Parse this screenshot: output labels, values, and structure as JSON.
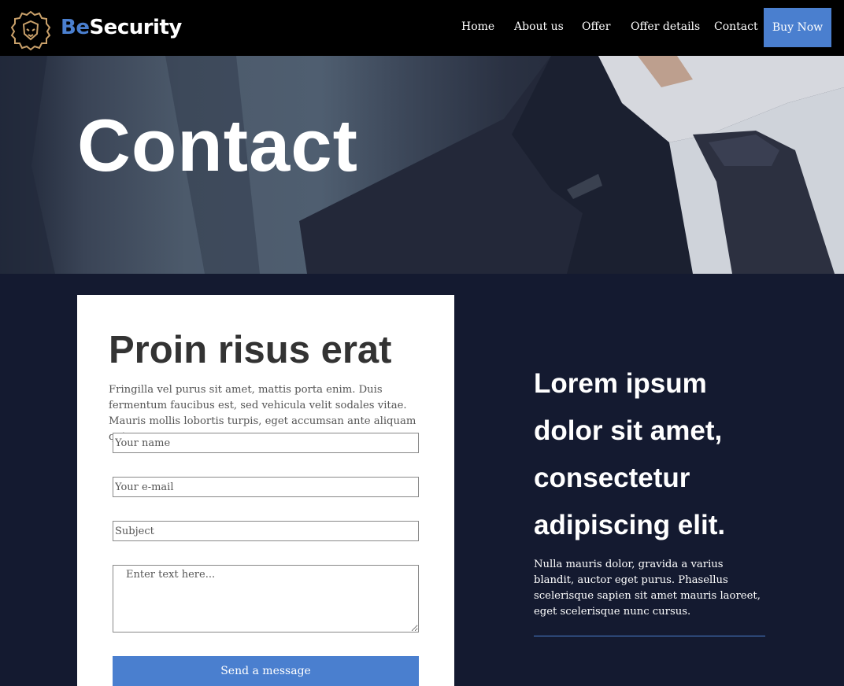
{
  "brand": {
    "name_part1": "Be",
    "name_part2": "Security",
    "logo_icon": "lion-head-icon",
    "accent": "#4a7fcf",
    "gold": "#c9a06a"
  },
  "nav": {
    "items": [
      "Home",
      "About us",
      "Offer",
      "Offer details",
      "Contact"
    ],
    "cta": "Buy Now"
  },
  "hero": {
    "title": "Contact"
  },
  "form": {
    "title": "Proin risus erat",
    "text": "Fringilla vel purus sit amet, mattis porta enim. Duis fermentum faucibus est, sed vehicula velit sodales vitae. Mauris mollis lobortis turpis, eget accumsan ante aliquam quis.",
    "name_placeholder": "Your name",
    "email_placeholder": "Your e-mail",
    "subject_placeholder": "Subject",
    "message_placeholder": "Enter text here...",
    "submit": "Send a message"
  },
  "aside": {
    "title": "Lorem ipsum dolor sit amet, consectetur adipiscing elit.",
    "text": "Nulla mauris dolor, gravida a varius blandit, auctor eget purus. Phasellus scelerisque sapien sit amet mauris laoreet, eget scelerisque nunc cursus."
  },
  "colors": {
    "nav_bg": "#000000",
    "page_bg": "#141a30",
    "card_bg": "#ffffff"
  }
}
